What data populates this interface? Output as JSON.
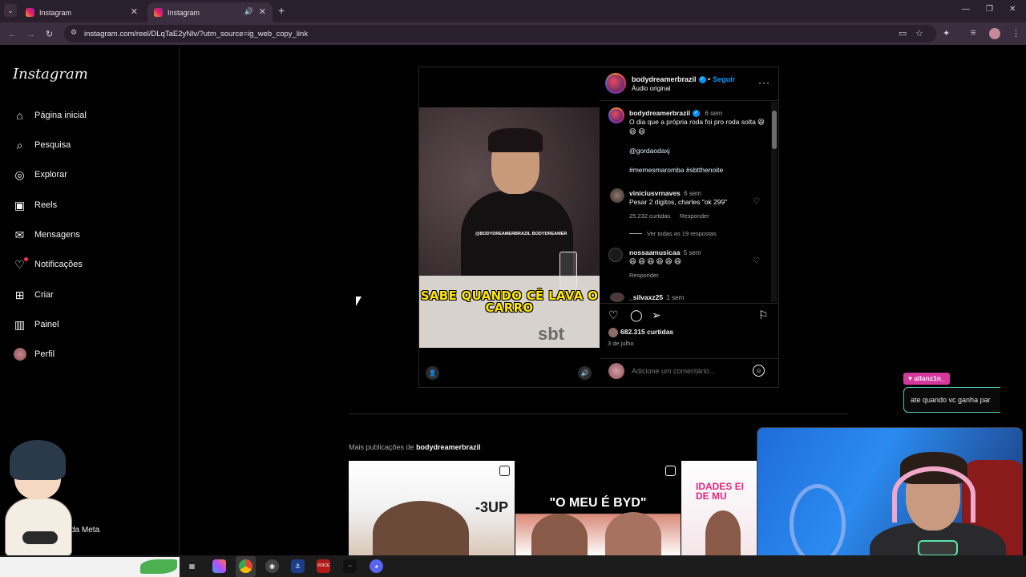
{
  "browser": {
    "tabs": [
      {
        "title": "Instagram",
        "active": false
      },
      {
        "title": "Instagram",
        "active": true
      }
    ],
    "new_tab_icon": "plus-icon",
    "url": "instagram.com/reel/DLqTaE2yNlv/?utm_source=ig_web_copy_link"
  },
  "sidebar": {
    "logo": "Instagram",
    "items": [
      {
        "label": "Página inicial",
        "icon": "home-icon"
      },
      {
        "label": "Pesquisa",
        "icon": "search-icon"
      },
      {
        "label": "Explorar",
        "icon": "compass-icon"
      },
      {
        "label": "Reels",
        "icon": "reels-icon"
      },
      {
        "label": "Mensagens",
        "icon": "messenger-icon"
      },
      {
        "label": "Notificações",
        "icon": "heart-icon"
      },
      {
        "label": "Criar",
        "icon": "plus-square-icon"
      },
      {
        "label": "Painel",
        "icon": "chart-icon"
      },
      {
        "label": "Perfil",
        "icon": "avatar"
      }
    ],
    "more_label": "da Meta"
  },
  "reel": {
    "video_caption": "SABE QUANDO CÊ LAVA O CARRO",
    "video_badge": "@BODYDREAMERBRAZIL BODYDREAMER",
    "video_logo": "sbt",
    "header": {
      "username": "bodydreamerbrazil",
      "follow": "Seguir",
      "separator": "•",
      "audio": "Áudio original",
      "more": "···"
    },
    "post": {
      "username": "bodydreamerbrazil",
      "time": "6 sem",
      "text": "O dia que a própria roda foi pro roda solta 😆 😆 😆",
      "mention": "@gordaodaxj",
      "hashtags": "#memesmaromba #sbtthenoite"
    },
    "comments": [
      {
        "username": "viniciusvrnaves",
        "time": "6 sem",
        "text": "Pesar 2 digitos, charles \"ok 299\"",
        "likes": "25.232 curtidas",
        "reply": "Responder",
        "view_replies": "Ver todas as 19 respostas"
      },
      {
        "username": "nossaamusicaa",
        "time": "5 sem",
        "text": "😆 😆 😆 😆 😆 😆",
        "reply": "Responder"
      },
      {
        "username": "_silvaxz25",
        "time": "1 sem"
      }
    ],
    "likes": "682.315 curtidas",
    "date": "3 de julho",
    "comment_placeholder": "Adicione um comentário..."
  },
  "more_posts": {
    "prefix": "Mais publicações de",
    "username": "bodydreamerbrazil",
    "thumbs": [
      {
        "text": "-3UP"
      },
      {
        "text": "\"O MEU É BYD\""
      },
      {
        "text": "IDADES EI DE MU"
      }
    ]
  },
  "chat": {
    "name": "allanz1n_",
    "message": "ate quando vc ganha par"
  },
  "colors": {
    "accent_blue": "#0095f6",
    "notification_red": "#ff3040",
    "chat_tag": "#d43a9e"
  }
}
